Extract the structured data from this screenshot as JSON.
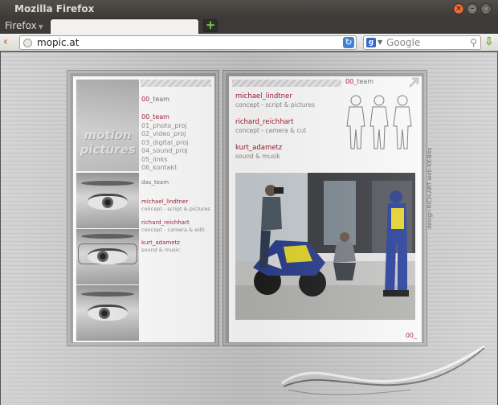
{
  "window": {
    "title": "Mozilla Firefox"
  },
  "menu": {
    "firefox_label": "Firefox"
  },
  "navbar": {
    "url": "mopic.at",
    "search_placeholder": "Google"
  },
  "page": {
    "logo": {
      "line1": "motion",
      "line2": "pictures"
    },
    "left": {
      "header_num": "00",
      "header_label": "_team",
      "nav": [
        {
          "num": "00",
          "label": "_team",
          "active": true
        },
        {
          "label": "01_photo_proj"
        },
        {
          "label": "02_video_proj"
        },
        {
          "label": "03_digital_proj"
        },
        {
          "label": "04_sound_proj"
        },
        {
          "label": "05_links"
        },
        {
          "label": "06_kontakt"
        }
      ],
      "team_heading": "das_team",
      "team": [
        {
          "name": "michael_lindtner",
          "role": "concept - script & pictures"
        },
        {
          "name": "richard_reichhart",
          "role": "concept - camera & edit"
        },
        {
          "name": "kurt_adametz",
          "role": "sound & music"
        }
      ]
    },
    "right": {
      "header_num": "00",
      "header_label": "_team",
      "members": [
        {
          "name": "michael_lindtner",
          "role": "concept - script & pictures"
        },
        {
          "name": "richard_reichhart",
          "role": "concept - camera & cut"
        },
        {
          "name": "kurt_adametz",
          "role": "sound & musik"
        }
      ],
      "footer": "00_"
    },
    "credits": "design-RICH.ART  web-KK-Bits"
  }
}
